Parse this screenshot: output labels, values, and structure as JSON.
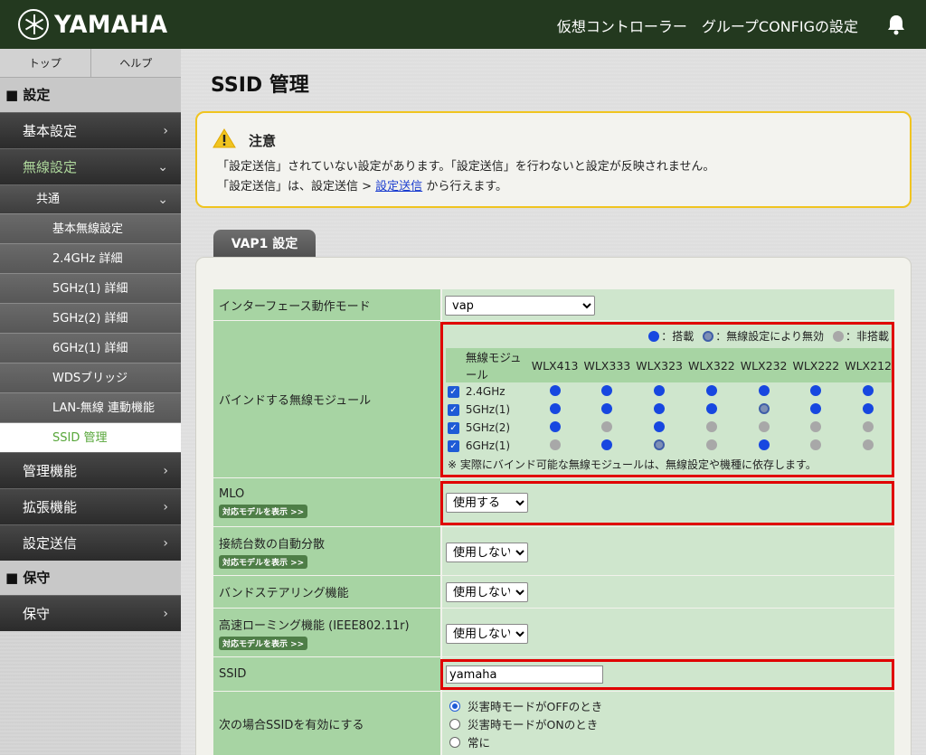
{
  "header": {
    "brand": "YAMAHA",
    "nav": [
      "仮想コントローラー",
      "グループCONFIGの設定"
    ],
    "icons": {
      "logo": "yamaha-tuning-forks-logo",
      "notify": "bell-icon"
    }
  },
  "sidebar": {
    "tabs": [
      "トップ",
      "ヘルプ"
    ],
    "section_settings": "■ 設定",
    "basic": "基本設定",
    "wireless": "無線設定",
    "common": "共通",
    "sub": [
      "基本無線設定",
      "2.4GHz 詳細",
      "5GHz(1) 詳細",
      "5GHz(2) 詳細",
      "6GHz(1) 詳細",
      "WDSブリッジ",
      "LAN-無線 連動機能",
      "SSID 管理"
    ],
    "admin": "管理機能",
    "ext": "拡張機能",
    "send": "設定送信",
    "section_maint": "■ 保守",
    "maint": "保守"
  },
  "main": {
    "title": "SSID 管理",
    "notice": {
      "title": "注意",
      "line1": "「設定送信」されていない設定があります。「設定送信」を行わないと設定が反映されません。",
      "line2_pre": "「設定送信」は、設定送信 > ",
      "line2_link": "設定送信",
      "line2_post": " から行えます。"
    },
    "vap_tab": "VAP1 設定",
    "rows": {
      "if_mode": {
        "label": "インターフェース動作モード",
        "value": "vap"
      },
      "bind": {
        "label": "バインドする無線モジュール"
      },
      "mlo": {
        "label": "MLO",
        "btn": "対応モデルを表示 >>",
        "value": "使用する"
      },
      "lb": {
        "label": "接続台数の自動分散",
        "btn": "対応モデルを表示 >>",
        "value": "使用しない"
      },
      "band": {
        "label": "バンドステアリング機能",
        "value": "使用しない"
      },
      "roam": {
        "label": "高速ローミング機能 (IEEE802.11r)",
        "btn": "対応モデルを表示 >>",
        "value": "使用しない"
      },
      "ssid": {
        "label": "SSID",
        "value": "yamaha"
      },
      "enable": {
        "label": "次の場合SSIDを有効にする",
        "options": [
          "災害時モードがOFFのとき",
          "災害時モードがONのとき",
          "常に"
        ],
        "selected": 0
      }
    },
    "legend": {
      "on": "：搭載",
      "dis": "：無線設定により無効",
      "off": "：非搭載"
    },
    "modules": {
      "header": "無線モジュール",
      "models": [
        "WLX413",
        "WLX333",
        "WLX323",
        "WLX322",
        "WLX232",
        "WLX222",
        "WLX212"
      ],
      "bands": [
        {
          "name": "2.4GHz",
          "checked": true,
          "states": [
            "on",
            "on",
            "on",
            "on",
            "on",
            "on",
            "on"
          ]
        },
        {
          "name": "5GHz(1)",
          "checked": true,
          "states": [
            "on",
            "on",
            "on",
            "on",
            "dis",
            "on",
            "on"
          ]
        },
        {
          "name": "5GHz(2)",
          "checked": true,
          "states": [
            "on",
            "off",
            "on",
            "off",
            "off",
            "off",
            "off"
          ]
        },
        {
          "name": "6GHz(1)",
          "checked": true,
          "states": [
            "off",
            "on",
            "dis",
            "off",
            "on",
            "off",
            "off"
          ]
        }
      ],
      "note": "※ 実際にバインド可能な無線モジュールは、無線設定や機種に依存します。"
    },
    "colors": {
      "accent": "#57a639",
      "alert": "#e00000",
      "header": "#23391f"
    }
  }
}
